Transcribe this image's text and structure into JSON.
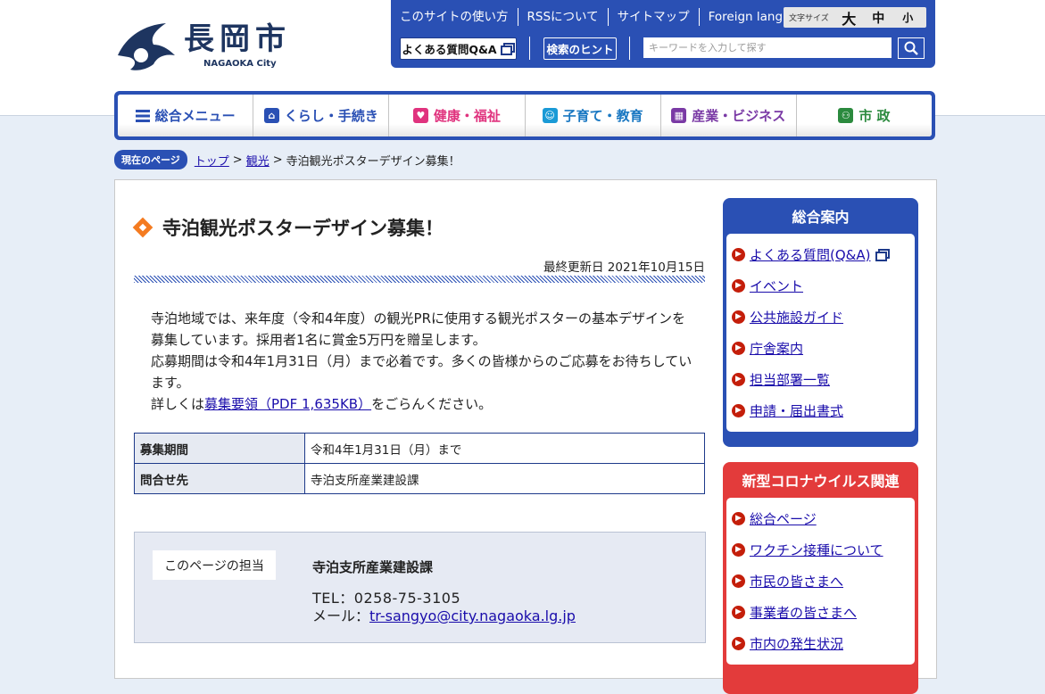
{
  "header": {
    "logo": {
      "name": "長岡市",
      "sub": "NAGAOKA City"
    },
    "util_links": [
      "このサイトの使い方",
      "RSSについて",
      "サイトマップ",
      "Foreign language"
    ],
    "font_size": {
      "label": "文字サイズ",
      "large": "大",
      "medium": "中",
      "small": "小"
    },
    "faq_button": "よくある質問Q&A",
    "hint_button": "検索のヒント",
    "search": {
      "placeholder": "キーワードを入力して探す"
    }
  },
  "gnav": {
    "items": [
      {
        "label": "総合メニュー",
        "icon": "menu-icon"
      },
      {
        "label": "くらし・手続き",
        "icon": "house-icon"
      },
      {
        "label": "健康・福祉",
        "icon": "heart-icon"
      },
      {
        "label": "子育て・教育",
        "icon": "child-icon"
      },
      {
        "label": "産業・ビジネス",
        "icon": "building-icon"
      },
      {
        "label": "市 政",
        "icon": "people-icon"
      }
    ]
  },
  "breadcrumb": {
    "badge": "現在のページ",
    "items": [
      "トップ",
      "観光"
    ],
    "current": "寺泊観光ポスターデザイン募集！"
  },
  "article": {
    "title": "寺泊観光ポスターデザイン募集！",
    "updated": "最終更新日 2021年10月15日",
    "para1": "寺泊地域では、来年度（令和4年度）の観光PRに使用する観光ポスターの基本デザインを募集しています。採用者1名に賞金5万円を贈呈します。",
    "para2": "応募期間は令和4年1月31日（月）まで必着です。多くの皆様からのご応募をお待ちしています。",
    "para3_prefix": "詳しくは",
    "para3_link": "募集要領（PDF 1,635KB）",
    "para3_suffix": "をごらんください。",
    "table": [
      {
        "label": "募集期間",
        "value": "令和4年1月31日（月）まで"
      },
      {
        "label": "問合せ先",
        "value": "寺泊支所産業建設課"
      }
    ]
  },
  "contact": {
    "label": "このページの担当",
    "dept": "寺泊支所産業建設課",
    "tel": "TEL：0258-75-3105",
    "mail_label": "メール：",
    "mail": "tr-sangyo@city.nagaoka.lg.jp"
  },
  "sidebar": {
    "guide": {
      "title": "総合案内",
      "items": [
        "よくある質問(Q&A)",
        "イベント",
        "公共施設ガイド",
        "庁舎案内",
        "担当部署一覧",
        "申請・届出書式"
      ]
    },
    "covid": {
      "title": "新型コロナウイルス関連",
      "items": [
        "総合ページ",
        "ワクチン接種について",
        "市民の皆さまへ",
        "事業者の皆さまへ",
        "市内の発生状況"
      ]
    }
  },
  "colors": {
    "primary_blue": "#2a50b4",
    "accent_orange": "#f47b20",
    "covid_red": "#e33b3b"
  }
}
